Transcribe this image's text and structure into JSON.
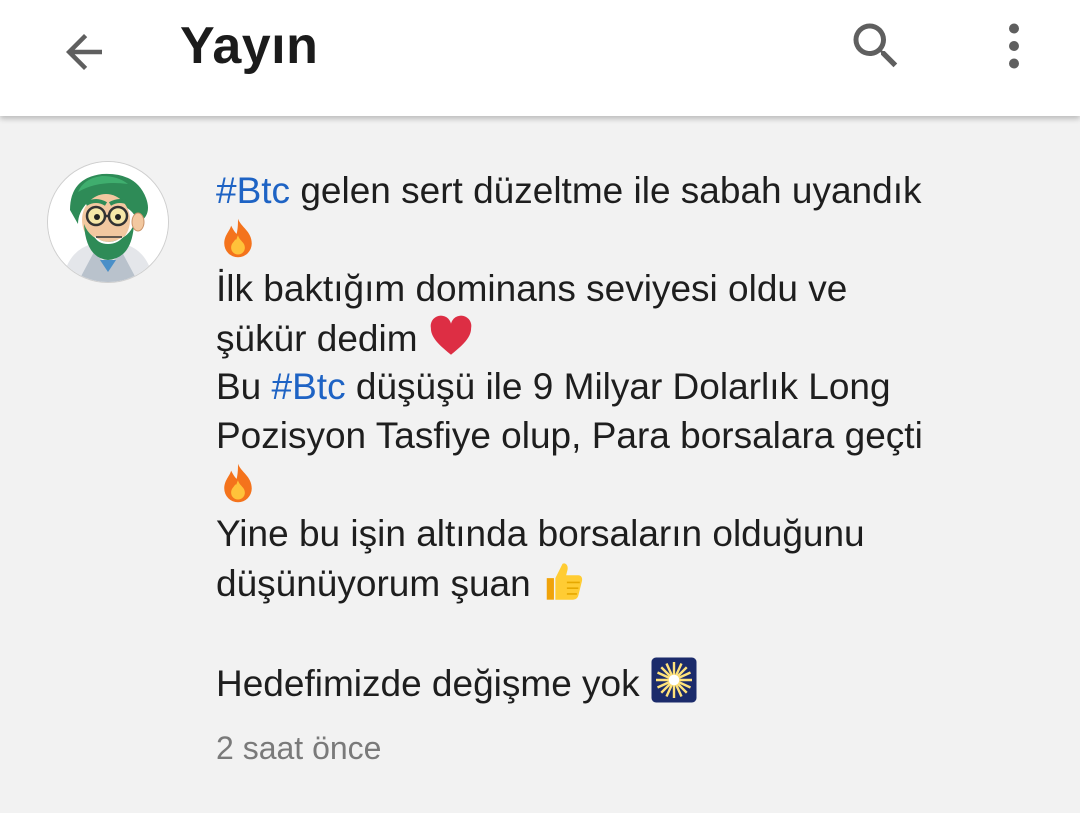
{
  "appbar": {
    "title": "Yayın",
    "back_icon": "arrow-left-icon",
    "search_icon": "search-icon",
    "more_icon": "more-vertical-icon"
  },
  "post": {
    "avatar_icon": "bearded-character-avatar",
    "lines": {
      "l1_tag": "#Btc",
      "l1_text": " gelen sert düzeltme ile sabah uyandık",
      "l3_text": "İlk baktığım dominans seviyesi oldu ve",
      "l4_text": "şükür dedim ",
      "l5_prefix": "Bu ",
      "l5_tag": "#Btc",
      "l5_text": " düşüşü ile 9 Milyar Dolarlık Long",
      "l6_text": "Pozisyon Tasfiye olup, Para borsalara geçti",
      "l8_text": "Yine bu işin altında borsaların olduğunu",
      "l9_text": "düşünüyorum şuan ",
      "l11_text": "Hedefimizde değişme yok "
    },
    "emojis": [
      "fire-emoji",
      "red-heart-emoji",
      "fire-emoji",
      "thumbs-up-emoji",
      "sparkler-emoji"
    ],
    "timestamp": "2 saat önce"
  },
  "colors": {
    "hashtag": "#1e63c4",
    "background": "#f2f2f2",
    "appbar": "#ffffff",
    "timestamp": "#7a7a7a"
  }
}
